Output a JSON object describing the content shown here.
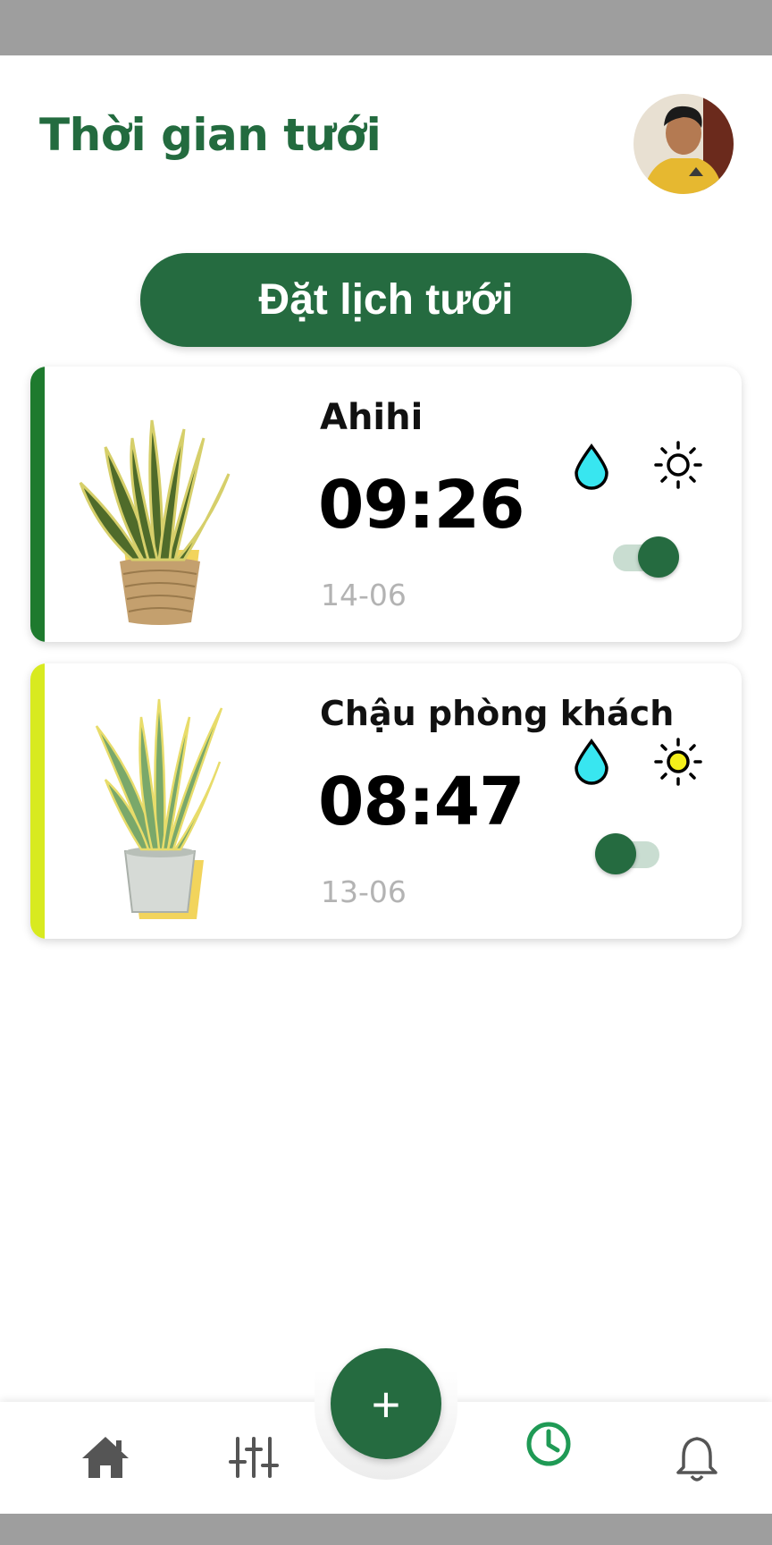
{
  "header": {
    "title": "Thời gian tưới"
  },
  "actions": {
    "schedule_label": "Đặt lịch tưới"
  },
  "schedules": [
    {
      "name": "Ahihi",
      "time": "09:26",
      "date": "14-06",
      "enabled": true,
      "stripe_color": "#1e7a2e",
      "sun_fill": "#ffffff"
    },
    {
      "name": "Chậu phòng khách",
      "time": "08:47",
      "date": "13-06",
      "enabled": false,
      "stripe_color": "#d8ea20",
      "sun_fill": "#f4ef1a"
    }
  ],
  "fab": {
    "label": "+"
  },
  "tabbar": {
    "items": [
      "home-icon",
      "sliders-icon",
      "clock-icon",
      "bell-icon"
    ],
    "active": "clock-icon"
  },
  "colors": {
    "primary": "#256b40",
    "water": "#38e6f0",
    "active_tab": "#1f9a55"
  }
}
